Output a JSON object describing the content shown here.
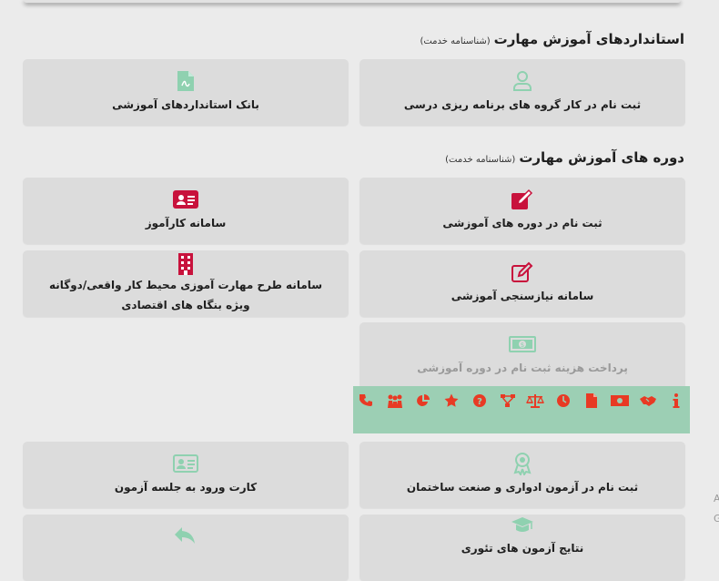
{
  "sections": {
    "standards": {
      "title": "استانداردهای آموزش مهارت",
      "subtitle": "(شناسنامه خدمت)"
    },
    "courses": {
      "title": "دوره های آموزش مهارت",
      "subtitle": "(شناسنامه خدمت)"
    }
  },
  "cards": {
    "register_group": {
      "label": "ثبت نام در کار گروه های برنامه ریزی درسی",
      "icon": "user-icon"
    },
    "standards_bank": {
      "label": "بانک استانداردهای آموزشی",
      "icon": "pdf-file-icon"
    },
    "course_register": {
      "label": "ثبت نام در دوره های آموزشی",
      "icon": "edit-icon"
    },
    "karamouz": {
      "label": "سامانه کارآموز",
      "icon": "id-card-icon"
    },
    "needs_assessment": {
      "label": "سامانه نیازسنجی آموزشی",
      "icon": "edit-icon"
    },
    "workplace_training": {
      "label_line1": "سامانه طرح مهارت آموزی محیط کار واقعی/دوگانه",
      "label_line2": "ویژه بنگاه های اقتصادی",
      "icon": "building-icon"
    },
    "payment": {
      "label": "پرداخت هزینه ثبت نام در دوره آموزشی",
      "icon": "money-icon"
    },
    "exam_register": {
      "label": "ثبت نام در آزمون ادواری و صنعت ساختمان",
      "icon": "award-icon"
    },
    "exam_card": {
      "label": "کارت ورود به جلسه آزمون",
      "icon": "id-card-icon"
    },
    "theory_results": {
      "label": "نتایج آزمون های تئوری",
      "icon": "graduation-cap-icon"
    },
    "partial_bottom": {
      "label": "",
      "icon": "reply-icon"
    }
  },
  "toolbar": {
    "items": [
      "phone-icon",
      "users-icon",
      "pie-chart-icon",
      "star-icon",
      "question-icon",
      "sitemap-icon",
      "balance-scale-icon",
      "clock-icon",
      "file-icon",
      "money-bill-icon",
      "handshake-icon",
      "info-icon"
    ]
  },
  "colors": {
    "background": "#ebebeb",
    "card": "#dcdcdc",
    "accent_red": "#c8123c",
    "accent_green": "#8fd1b0",
    "toolbar_bg": "#9ccfb4",
    "toolbar_icon": "#e83a24"
  },
  "edge_text": {
    "char1": "A",
    "char2": "G"
  }
}
